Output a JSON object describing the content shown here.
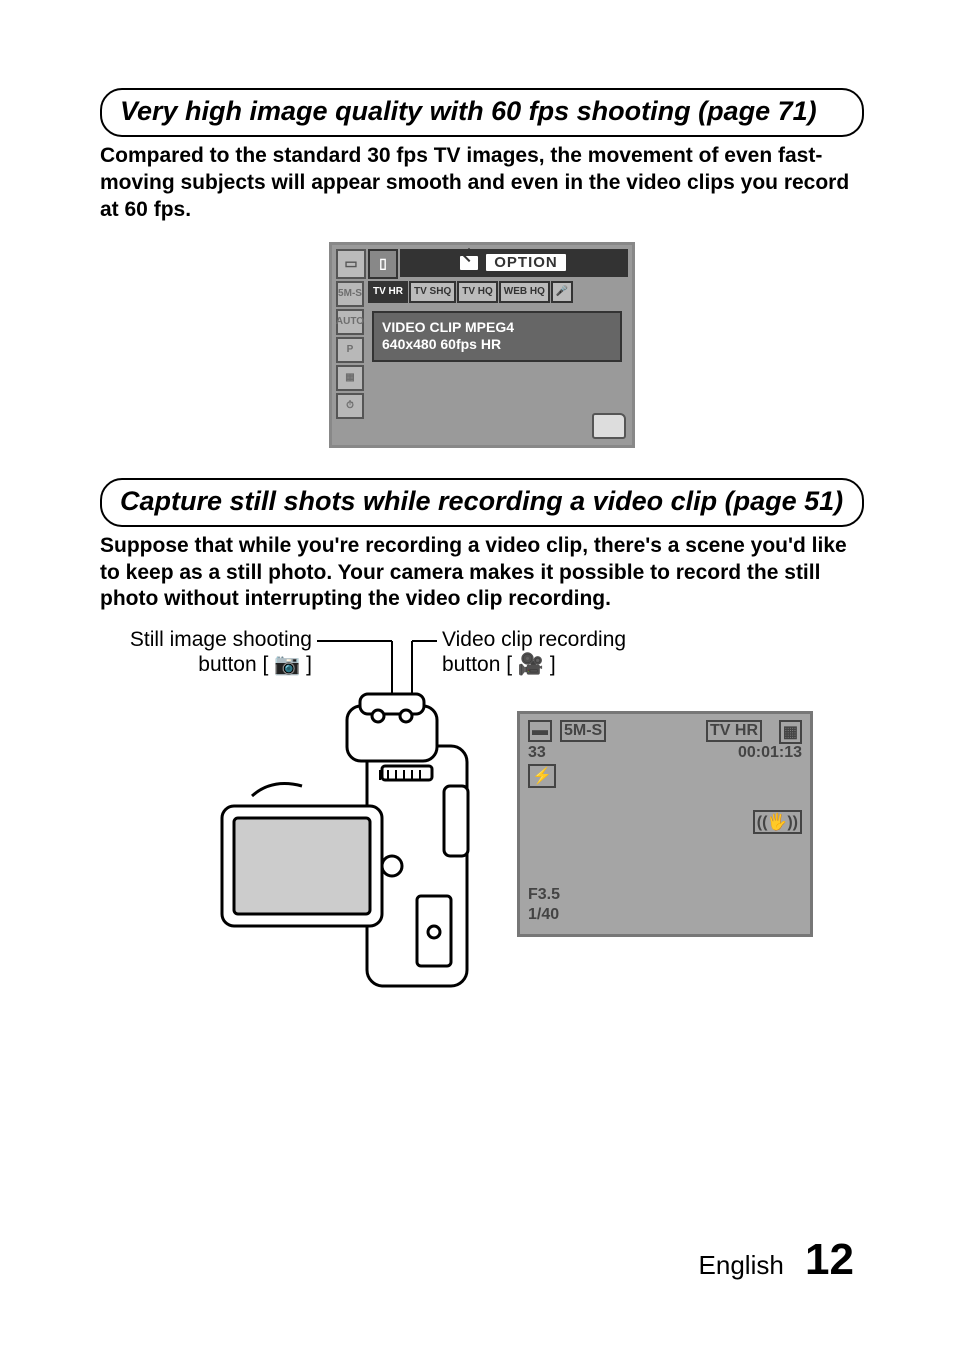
{
  "section1": {
    "heading": "Very high image quality with 60 fps shooting (page 71)",
    "body": "Compared to the standard 30 fps TV images, the movement of even fast-moving subjects will appear smooth and even in the video clips you record at 60 fps."
  },
  "menu": {
    "option_label": "OPTION",
    "row2": [
      "TV HR",
      "TV SHQ",
      "TV HQ",
      "WEB HQ",
      "🎤"
    ],
    "side": [
      "5M-S",
      "AUTO",
      "P",
      "▦",
      "⏱"
    ],
    "msg_line1": "VIDEO CLIP MPEG4",
    "msg_line2": "640x480 60fps HR"
  },
  "section2": {
    "heading": "Capture still shots while recording a video clip (page 51)",
    "body": "Suppose that while you're recording a video clip, there's a scene you'd like to keep as a still photo. Your camera makes it possible to record the still photo without interrupting the video clip recording."
  },
  "diagram": {
    "still_label_l1": "Still image shooting",
    "still_label_l2": "button [ 📷 ]",
    "video_label_l1": "Video clip recording",
    "video_label_l2": "button [ 🎥 ]"
  },
  "osd": {
    "top_left_mode": "5M-S",
    "count": "33",
    "top_right_mode": "TV HR",
    "time": "00:01:13",
    "aperture": "F3.5",
    "shutter": "1/40",
    "stab": "((🖐))"
  },
  "footer": {
    "lang": "English",
    "page": "12"
  }
}
